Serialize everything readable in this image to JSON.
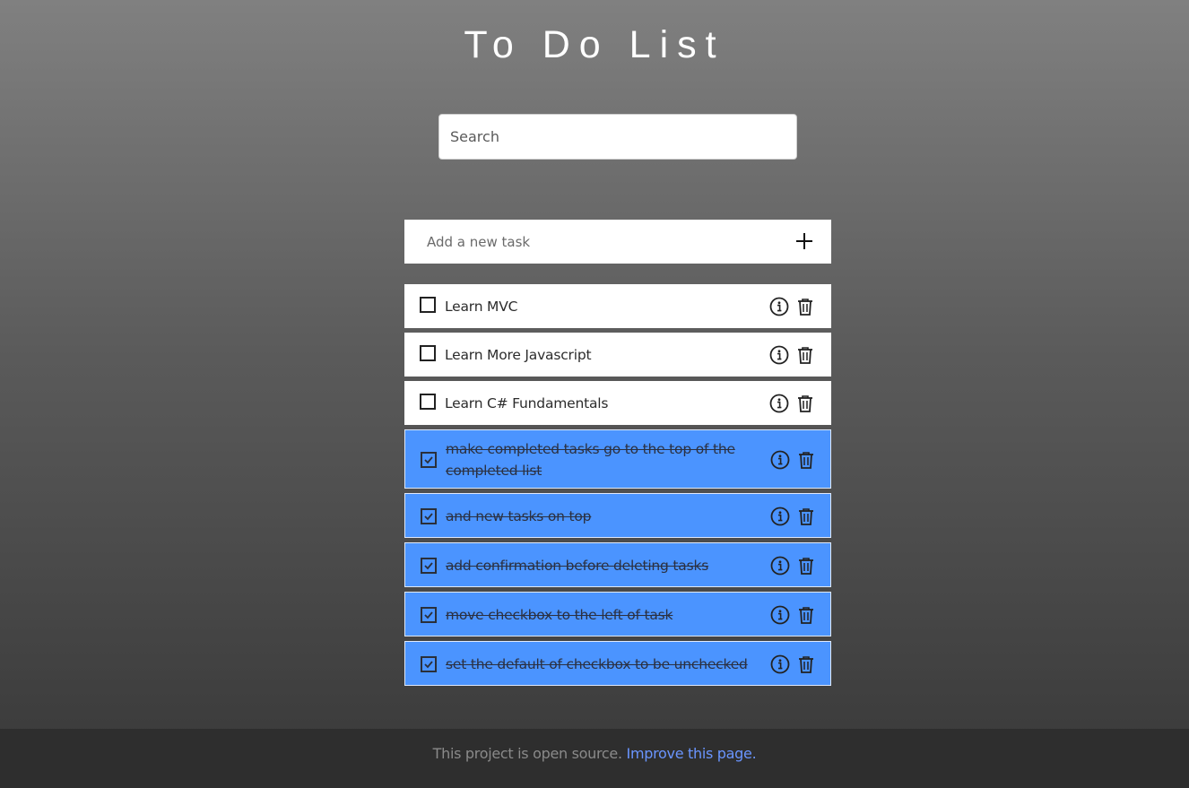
{
  "app": {
    "title": "To Do List"
  },
  "search": {
    "placeholder": "Search",
    "value": ""
  },
  "new_task": {
    "placeholder": "Add a new task",
    "value": "",
    "add_icon": "plus-icon"
  },
  "tasks": [
    {
      "text": "Learn MVC",
      "completed": false
    },
    {
      "text": "Learn More Javascript",
      "completed": false
    },
    {
      "text": "Learn C# Fundamentals",
      "completed": false
    },
    {
      "text": "make completed tasks go to the top of the completed list",
      "completed": true
    },
    {
      "text": "and new tasks on top",
      "completed": true
    },
    {
      "text": "add confirmation before deleting tasks",
      "completed": true
    },
    {
      "text": "move checkbox to the left of task",
      "completed": true
    },
    {
      "text": "set the default of checkbox to be unchecked",
      "completed": true
    }
  ],
  "task_icons": {
    "info": "info-icon",
    "delete": "trash-icon",
    "checkbox": "checkbox-icon"
  },
  "colors": {
    "completed_bg": "#4b94ff",
    "footer_link": "#6a95ff"
  },
  "footer": {
    "text": "This project is open source.",
    "link_label": "Improve this page."
  }
}
